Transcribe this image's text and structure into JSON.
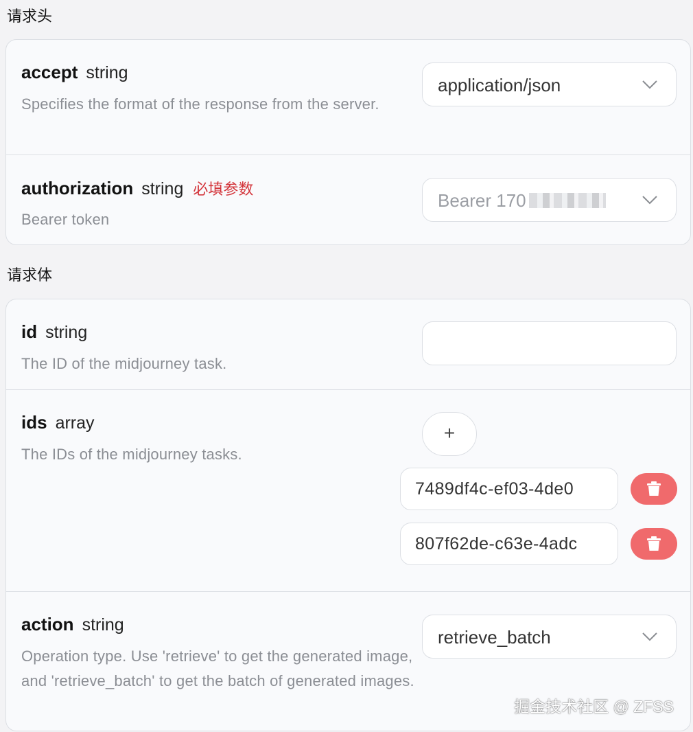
{
  "headers_section": {
    "title": "请求头",
    "params": [
      {
        "name": "accept",
        "type": "string",
        "required_label": "",
        "description": "Specifies the format of the response from the server.",
        "control": "select",
        "value": "application/json"
      },
      {
        "name": "authorization",
        "type": "string",
        "required_label": "必填参数",
        "description": "Bearer token",
        "control": "select",
        "value": "Bearer 170"
      }
    ]
  },
  "body_section": {
    "title": "请求体",
    "params": [
      {
        "name": "id",
        "type": "string",
        "description": "The ID of the midjourney task.",
        "control": "text",
        "value": ""
      },
      {
        "name": "ids",
        "type": "array",
        "description": "The IDs of the midjourney tasks.",
        "control": "array",
        "add_label": "+",
        "items": [
          "7489df4c-ef03-4de0",
          "807f62de-c63e-4adc"
        ]
      },
      {
        "name": "action",
        "type": "string",
        "description": "Operation type. Use 'retrieve' to get the generated image, and 'retrieve_batch' to get the batch of generated images.",
        "control": "select",
        "value": "retrieve_batch"
      }
    ]
  },
  "icons": {
    "dropdown": "chevron-down-icon",
    "delete": "trash-icon"
  },
  "colors": {
    "required": "#d3343a",
    "delete_button": "#f06a6c",
    "description": "#8b8e94"
  },
  "watermark": "掘金技术社区 @ ZFSS"
}
